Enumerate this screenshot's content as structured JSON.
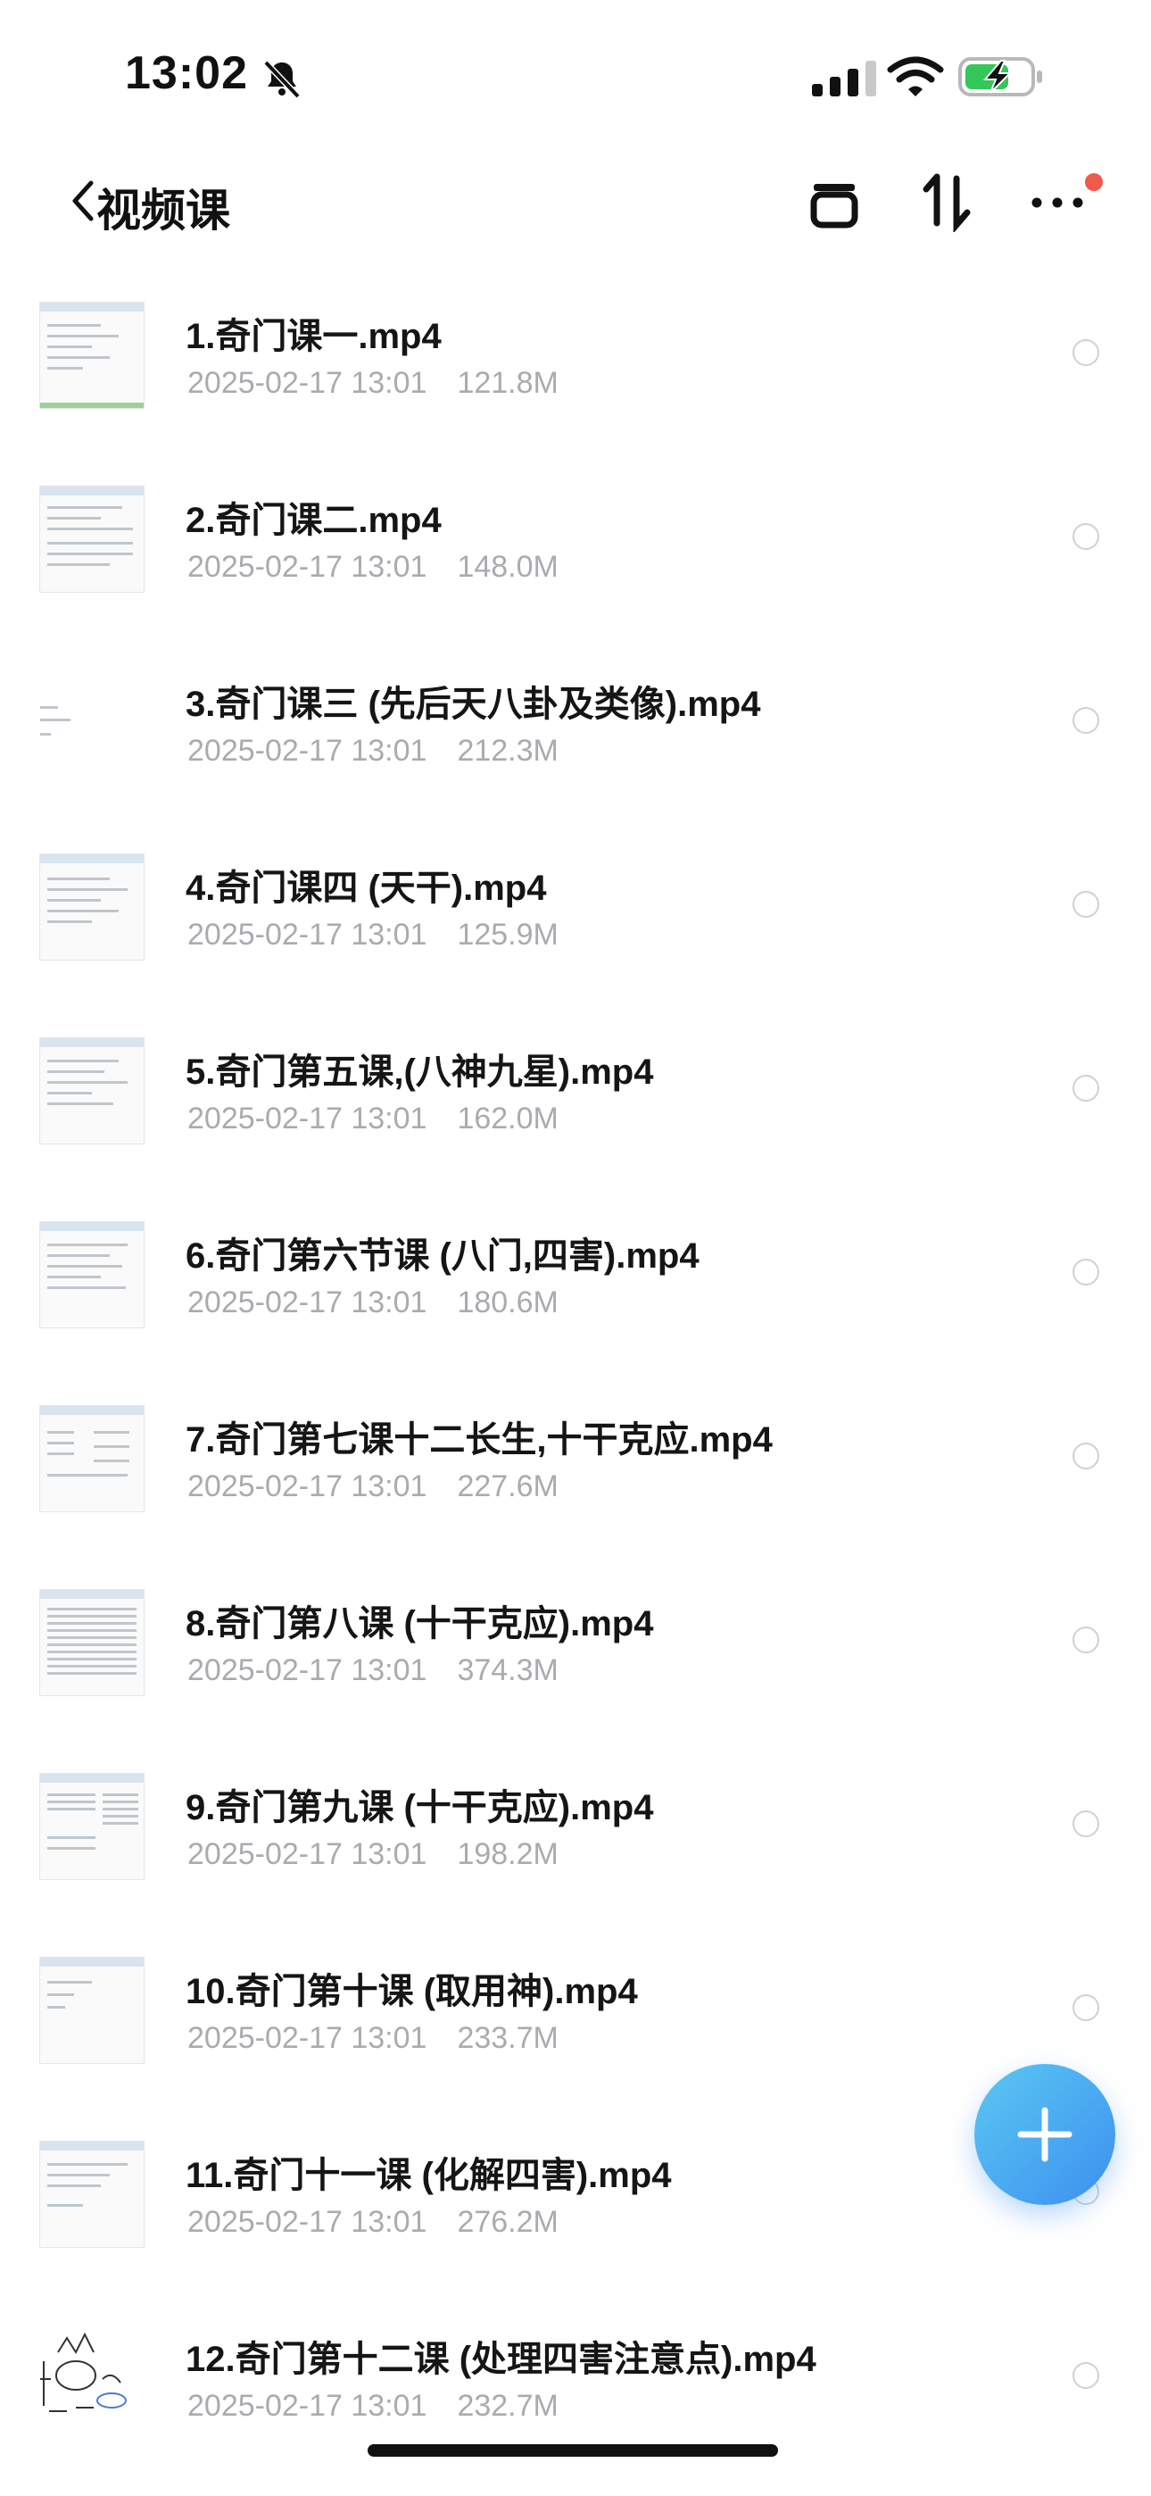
{
  "status_bar": {
    "time": "13:02"
  },
  "nav": {
    "back_label": "视频课"
  },
  "files": [
    {
      "name": "1.奇门课一.mp4",
      "date": "2025-02-17 13:01",
      "size": "121.8M"
    },
    {
      "name": "2.奇门课二.mp4",
      "date": "2025-02-17 13:01",
      "size": "148.0M"
    },
    {
      "name": "3.奇门课三 (先后天八卦及类像).mp4",
      "date": "2025-02-17 13:01",
      "size": "212.3M"
    },
    {
      "name": "4.奇门课四 (天干).mp4",
      "date": "2025-02-17 13:01",
      "size": "125.9M"
    },
    {
      "name": "5.奇门第五课,(八神九星).mp4",
      "date": "2025-02-17 13:01",
      "size": "162.0M"
    },
    {
      "name": "6.奇门第六节课 (八门,四害).mp4",
      "date": "2025-02-17 13:01",
      "size": "180.6M"
    },
    {
      "name": "7.奇门第七课十二长生,十干克应.mp4",
      "date": "2025-02-17 13:01",
      "size": "227.6M"
    },
    {
      "name": "8.奇门第八课 (十干克应).mp4",
      "date": "2025-02-17 13:01",
      "size": "374.3M"
    },
    {
      "name": "9.奇门第九课 (十干克应).mp4",
      "date": "2025-02-17 13:01",
      "size": "198.2M"
    },
    {
      "name": "10.奇门第十课 (取用神).mp4",
      "date": "2025-02-17 13:01",
      "size": "233.7M"
    },
    {
      "name": "11.奇门十一课 (化解四害).mp4",
      "date": "2025-02-17 13:01",
      "size": "276.2M"
    },
    {
      "name": "12.奇门第十二课 (处理四害注意点).mp4",
      "date": "2025-02-17 13:01",
      "size": "232.7M"
    }
  ],
  "icons": {
    "status": [
      "bell-slash-icon",
      "cellular-signal-icon",
      "wifi-icon",
      "battery-charging-icon"
    ],
    "nav": [
      "back-chevron-icon",
      "multi-select-icon",
      "sort-icon",
      "more-icon"
    ],
    "fab": "plus-icon"
  },
  "colors": {
    "accent_start": "#5bc8f2",
    "accent_end": "#3d8ff0",
    "notification_dot": "#ef5a4c",
    "meta_text": "#a9abaf",
    "battery_fill": "#34c759"
  }
}
